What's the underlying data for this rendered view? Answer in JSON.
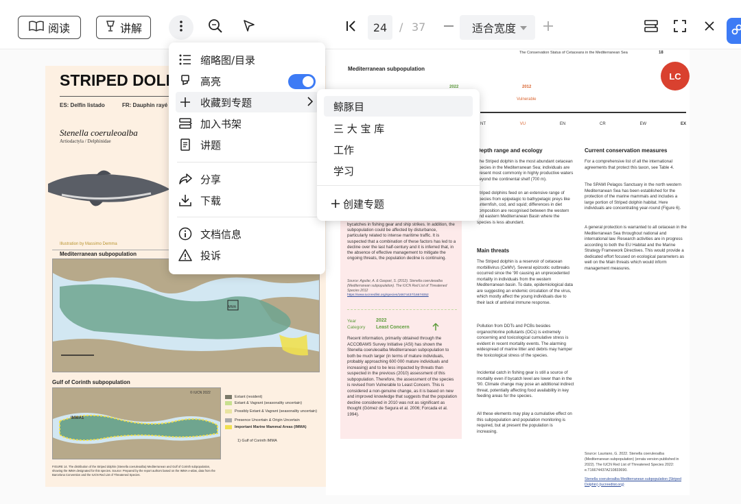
{
  "toolbar": {
    "read_label": "阅读",
    "explain_label": "讲解",
    "current_page": "24",
    "page_separator": "/",
    "total_pages": "37",
    "zoom_mode": "适合宽度"
  },
  "menu": {
    "items": [
      {
        "label": "缩略图/目录",
        "icon": "list-icon"
      },
      {
        "label": "高亮",
        "icon": "highlighter-icon",
        "toggle": true
      },
      {
        "label": "收藏到专题",
        "icon": "plus-icon",
        "has_submenu": true
      },
      {
        "label": "加入书架",
        "icon": "bookshelf-icon"
      },
      {
        "label": "讲题",
        "icon": "lecture-icon"
      },
      {
        "label": "分享",
        "icon": "share-icon"
      },
      {
        "label": "下载",
        "icon": "download-icon"
      },
      {
        "label": "文档信息",
        "icon": "info-icon"
      },
      {
        "label": "投诉",
        "icon": "warning-icon"
      }
    ]
  },
  "submenu": {
    "items": [
      "鲸豚目",
      "三 大 宝 库",
      "工作",
      "学习"
    ],
    "create_label": "创建专题"
  },
  "doc_left": {
    "title": "STRIPED DOLPHIN",
    "es_name": "ES: Delfín listado",
    "fr_name": "FR: Dauphin rayé",
    "species": "Stenella coeruleoalba",
    "family": "Artiodactyla / Delphinidae",
    "illustration_credit": "Illustration by Massimo Demma",
    "med_map_label": "Mediterranean subpopulation",
    "gulf_map_label": "Gulf of Corinth subpopulation",
    "legend": [
      "Extant (resident)",
      "Extant & Vagrant (seasonality uncertain)",
      "Possibly Extant & Vagrant (seasonality uncertain)",
      "Presence Uncertain & Origin Uncertain",
      "Important Marine Mammal Areas (IMMA)",
      "1) Gulf of Corinth IMMA"
    ],
    "imma_label": "IMMA",
    "imma1_label": "IMMA1",
    "iucn_mark": "© IUCN 2022",
    "figure_caption": "FIGURE 14. The distribution of the Striped dolphin (Stenella coeruleoalba) Mediterranean and Gulf of Corinth subpopulation, showing the IMMA designated for this species. Source: Prepared by the report authors based on the IMMA e-atlas, data from the Barcelona Convention and the IUCN Red List of Threatened Species."
  },
  "doc_right": {
    "header": "The Conservation Status of Cetaceans in the Mediterranean Sea",
    "page_no": "18",
    "subpop_title": "Mediterranean subpopulation",
    "year_2022": "2022",
    "year_2012": "2012",
    "vulnerable": "Vulnerable",
    "badge": "LC",
    "categories": [
      "NT",
      "VU",
      "EN",
      "CR",
      "EW",
      "EX"
    ],
    "depth_heading": "Depth range and ecology",
    "depth_text_1": "The Striped dolphin is the most abundant cetacean species in the Mediterranean Sea; individuals are present most commonly in highly productive waters beyond the continental shelf (700 m).",
    "depth_text_2": "Striped dolphins feed on an extensive range of species from epipelagic to bathypelagic preys like lanternfish, cod, and squid; differences in diet composition are recognised between the western and eastern Mediterranean Basin where the species is less abundant.",
    "threats_heading": "Main threats",
    "threats_text_1": "The Striped dolphin is a reservoir of cetacean morbillivirus (CeMV). Several epizootic outbreaks occurred since the '90 causing an unprecedented mortality in individuals from the western Mediterranean basin. To date, epidemiological data are suggesting an endemic circulation of the virus, which mostly affect the young individuals due to their lack of antiviral immune response.",
    "threats_text_2": "Pollution from DDTs and PCBs besides organochlorine pollutants (OCs) is extremely concerning and toxicological cumulative stress is evident in recent mortality events. The alarming widespread of marine litter and debris may hamper the toxicological stress of the species.",
    "threats_text_3": "Incidental catch in fishing gear is still a source of mortality even if bycatch level are lower than in the '90. Climate change may pose an additional indirect threat, potentially affecting food availability in key feeding areas for the species.",
    "threats_text_4": "All these elements may play a cumulative effect on this subpopulation and population monitoring is required, but at present the population is increasing.",
    "conservation_heading": "Current conservation measures",
    "conservation_text_1": "For a comprehensive list of all the international agreements that protect this taxon, see Table 4.",
    "conservation_text_2": "The SPAMI Pelagos Sanctuary in the north western Mediterranean Sea has been established for the protection of the marine mammals and includes a large portion of Striped dolphin habitat. Here individuals are concentrating year-round (Figure 6).",
    "conservation_text_3": "A general protection is warranted to all cetacean in the Mediterranean Sea throughout national and international law. Research activities are in progress according to both the EU Habitat and the Marine Strategy Framework Directives. This would provide a dedicated effort focused on ecological parameters as well on the Main threats which would inform management measures.",
    "pink_text_1": "bycatches in fishing gear and ship strikes. In addition, the subpopulation could be affected by disturbance, particularly related to intense maritime traffic. It is suspected that a combination of these factors has led to a decline over the last half-century and it is inferred that, in the absence of effective management to mitigate the ongoing threats, the population decline is continuing.",
    "pink_source": "Source: Aguilar, A. & Gaspari, S. (2012). Stenella coeruleoalba (Mediterranean subpopulation). The IUCN Red List of Threatened Species 2012",
    "pink_link": "https://www.iucnredlist.org/species/16674437/16674052",
    "year_label": "Year",
    "category_label": "Category",
    "pink_year": "2022",
    "pink_category": "Least Concern",
    "pink_text_2": "Recent information, primarily obtained through the ACCOBAMS Survey Initiative (ASI) has shown the Stenella coeruleoalba Mediterranean subpopulation to both be much larger (in terms of mature individuals, probably approaching 600 000 mature individuals and increasing) and to be less impacted by threats than suspected in the previous (2010) assessment of this subpopulation. Therefore, the assessment of the species is revised from Vulnerable to Least Concern. This is considered a non-genuine change, as it is based on new and improved knowledge that suggests that the population decline considered in 2010 was not as significant as thought (Gómez de Segura et al. 2006; Forcada et al. 1994).",
    "source_bottom": "Source: Lauriano, G. 2022. Stenella coeruleoalba (Mediterranean subpopulation) (errata version published in 2022). The IUCN Red List of Threatened Species 2022: e.T16674437A210833690.",
    "link_bottom": "Stenella coeruleoalba Mediterranean subpopulation (Striped Dolphin) (iucnredlist.org)"
  },
  "colors": {
    "accent": "#3d7bf5",
    "lc_badge": "#d9412f",
    "pink_bg": "#fdeaea",
    "green_text": "#5c9b3a",
    "vu_text": "#d9642f",
    "map_land": "#b7a98a",
    "map_sea": "#d2e7f2",
    "map_range": "#6fa58f",
    "imma_yellow": "#f0e050",
    "doc_left_bg": "#fdf0e2"
  }
}
